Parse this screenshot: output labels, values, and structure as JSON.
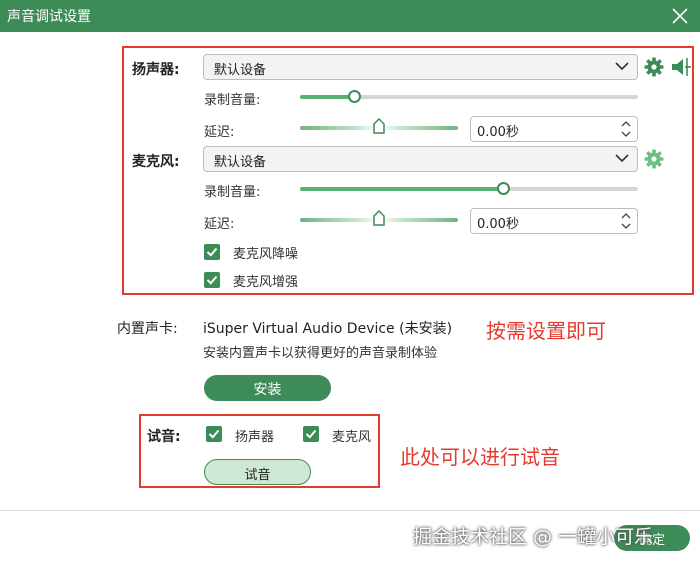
{
  "window": {
    "title": "声音调试设置"
  },
  "speaker": {
    "label": "扬声器:",
    "device": "默认设备",
    "volume_label": "录制音量:",
    "volume_level": 0.16,
    "delay_label": "延迟:",
    "delay_position": 0.5,
    "delay_value": "0.00秒"
  },
  "microphone": {
    "label": "麦克风:",
    "device": "默认设备",
    "volume_label": "录制音量:",
    "volume_level": 0.6,
    "delay_label": "延迟:",
    "delay_position": 0.5,
    "delay_value": "0.00秒",
    "noise_reduction": {
      "label": "麦克风降噪",
      "checked": true
    },
    "enhance": {
      "label": "麦克风增强",
      "checked": true
    }
  },
  "soundcard": {
    "label": "内置声卡:",
    "device_name": "iSuper Virtual Audio Device (未安装)",
    "hint": "安装内置声卡以获得更好的声音录制体验",
    "install_label": "安装"
  },
  "test": {
    "label": "试音:",
    "speaker": {
      "label": "扬声器",
      "checked": true
    },
    "microphone": {
      "label": "麦克风",
      "checked": true
    },
    "button_label": "试音"
  },
  "annotations": {
    "settings": "按需设置即可",
    "test": "此处可以进行试音"
  },
  "footer": {
    "confirm_label": "确定"
  },
  "watermark": "掘金技术社区 @ 一罐小可乐",
  "colors": {
    "accent": "#3d8b57",
    "annotation": "#e53b2e"
  }
}
